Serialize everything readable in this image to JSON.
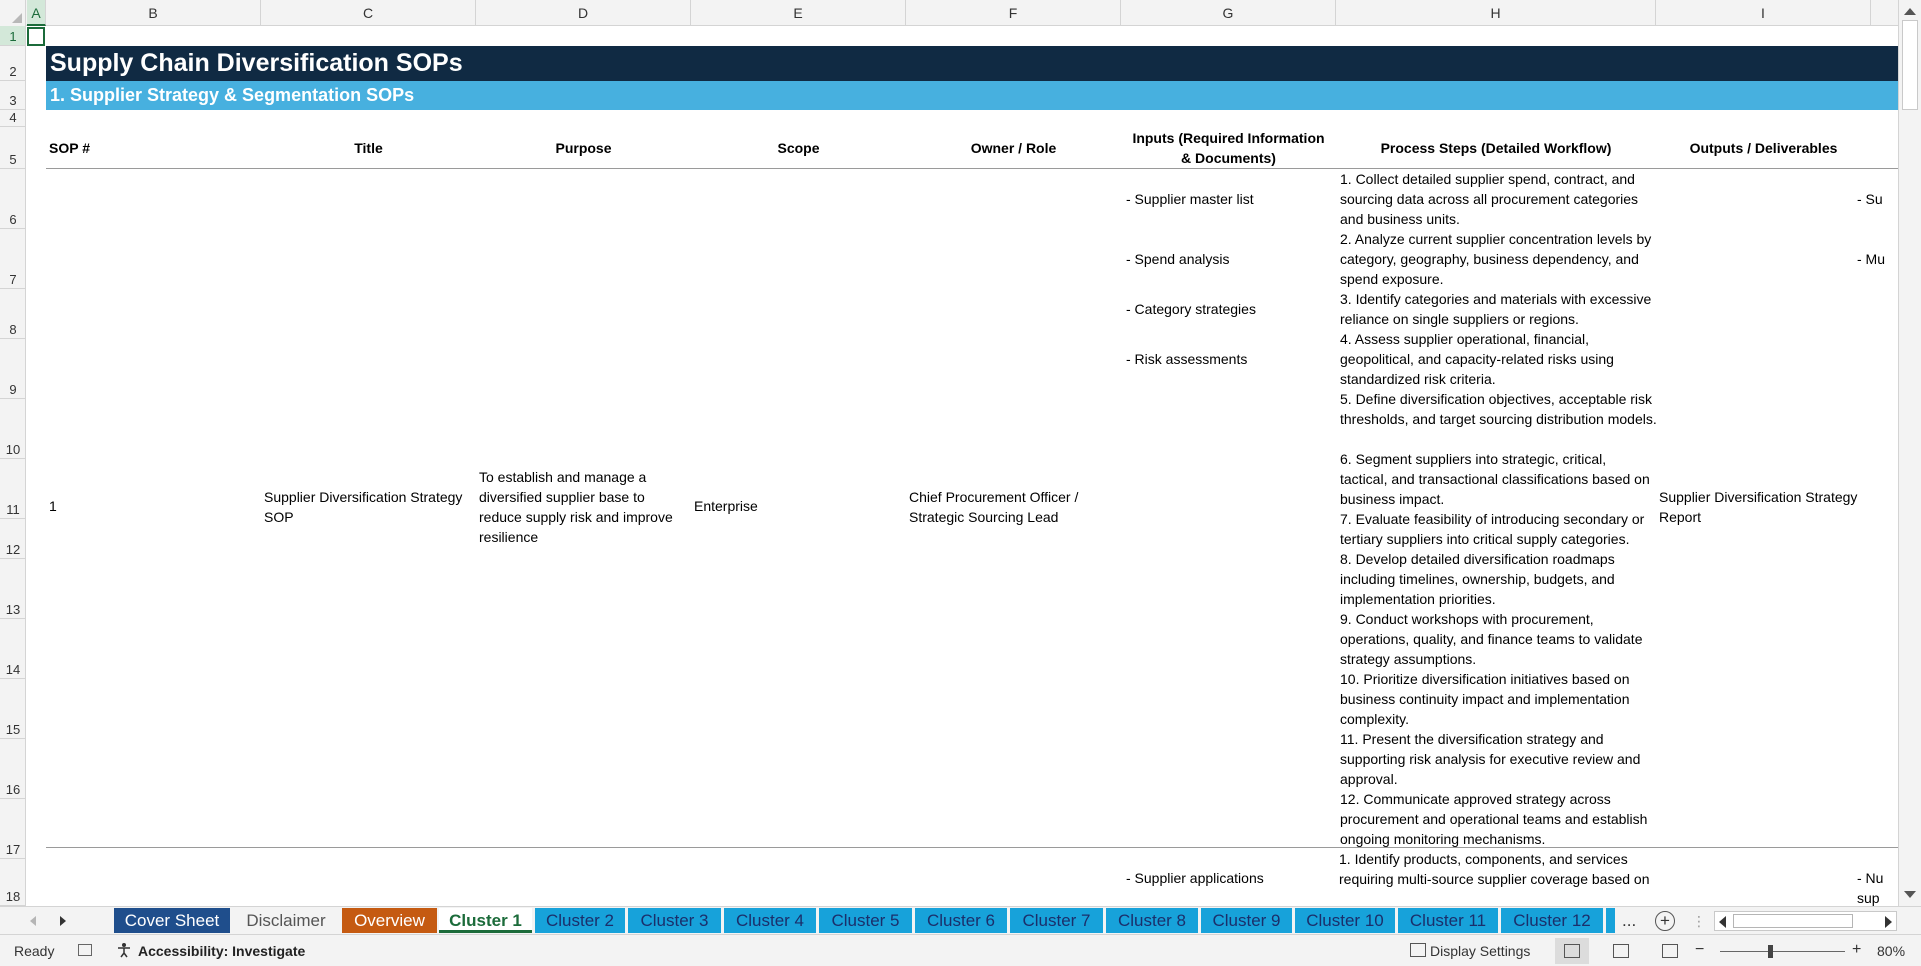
{
  "sheet": {
    "columns": [
      "A",
      "B",
      "C",
      "D",
      "E",
      "F",
      "G",
      "H",
      "I"
    ],
    "rows": [
      "1",
      "2",
      "3",
      "4",
      "5",
      "6",
      "7",
      "8",
      "9",
      "10",
      "11",
      "12",
      "13",
      "14",
      "15",
      "16",
      "17",
      "18"
    ],
    "title": "Supply Chain Diversification SOPs",
    "section": "1. Supplier Strategy & Segmentation SOPs",
    "headers": {
      "sop_num": "SOP #",
      "title": "Title",
      "purpose": "Purpose",
      "scope": "Scope",
      "owner": "Owner / Role",
      "inputs": "Inputs (Required Information & Documents)",
      "steps": "Process Steps (Detailed Workflow)",
      "outputs": "Outputs / Deliverables"
    },
    "sop1": {
      "number": "1",
      "title": "Supplier Diversification Strategy SOP",
      "purpose": "To establish and manage a diversified supplier base to reduce supply risk and improve resilience",
      "scope": "Enterprise",
      "owner": "Chief Procurement Officer / Strategic Sourcing Lead",
      "inputs": [
        "- Supplier master list",
        "- Spend analysis",
        "- Category strategies",
        "- Risk assessments"
      ],
      "steps": [
        "1. Collect detailed supplier spend, contract, and sourcing data across all procurement categories and business units.",
        "2. Analyze current supplier concentration levels by category, geography, business dependency, and spend exposure.",
        "3. Identify categories and materials with excessive reliance on single suppliers or regions.",
        "4. Assess supplier operational, financial, geopolitical, and capacity-related risks using standardized risk criteria.",
        "5. Define diversification objectives, acceptable risk thresholds, and target sourcing distribution models.",
        "6. Segment suppliers into strategic, critical, tactical, and transactional classifications based on business impact.",
        "7. Evaluate feasibility of introducing secondary or tertiary suppliers into critical supply categories.",
        "8. Develop detailed diversification roadmaps including timelines, ownership, budgets, and implementation priorities.",
        "9. Conduct workshops with procurement, operations, quality, and finance teams to validate strategy assumptions.",
        "10. Prioritize diversification initiatives based on business continuity impact and implementation complexity.",
        "11. Present the diversification strategy and supporting risk analysis for executive review and approval.",
        "12. Communicate approved strategy across procurement and operational teams and establish ongoing monitoring mechanisms."
      ],
      "output": "Supplier Diversification Strategy Report",
      "output_clipped": [
        "- Su",
        "- Mu"
      ]
    },
    "sop2": {
      "input": "- Supplier applications",
      "step": "1. Identify products, components, and services requiring multi-source supplier coverage based on",
      "output_clipped": [
        "- Nu",
        "sup"
      ]
    }
  },
  "tabs": [
    {
      "label": "Cover Sheet",
      "style": "cover"
    },
    {
      "label": "Disclaimer",
      "style": "disc"
    },
    {
      "label": "Overview",
      "style": "over"
    },
    {
      "label": "Cluster 1",
      "style": "active"
    },
    {
      "label": "Cluster 2",
      "style": "cluster"
    },
    {
      "label": "Cluster 3",
      "style": "cluster"
    },
    {
      "label": "Cluster 4",
      "style": "cluster"
    },
    {
      "label": "Cluster 5",
      "style": "cluster"
    },
    {
      "label": "Cluster 6",
      "style": "cluster"
    },
    {
      "label": "Cluster 7",
      "style": "cluster"
    },
    {
      "label": "Cluster 8",
      "style": "cluster"
    },
    {
      "label": "Cluster 9",
      "style": "cluster"
    },
    {
      "label": "Cluster 10",
      "style": "cluster"
    },
    {
      "label": "Cluster 11",
      "style": "cluster"
    },
    {
      "label": "Cluster 12",
      "style": "cluster"
    }
  ],
  "tab_more": "...",
  "tab_add": "+",
  "tab_menu": "⋮",
  "status": {
    "ready": "Ready",
    "accessibility": "Accessibility: Investigate",
    "display_settings": "Display Settings",
    "zoom_minus": "−",
    "zoom_plus": "+",
    "zoom": "80%"
  },
  "colors": {
    "title_band": "#102a43",
    "section_band": "#47b0df",
    "cluster_tab": "#17a2da",
    "cover_tab": "#1f4e8c",
    "overview_tab": "#c55a11",
    "selection": "#1b6b3a"
  }
}
